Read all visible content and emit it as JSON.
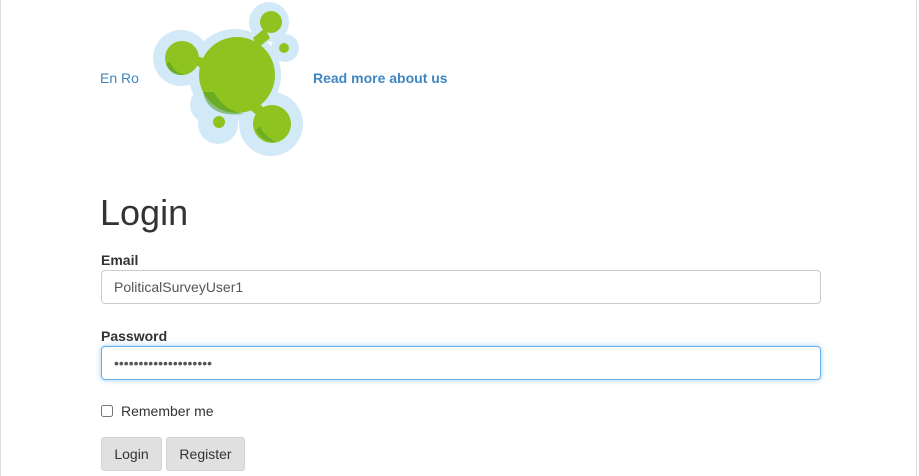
{
  "header": {
    "lang_en": "En",
    "lang_ro": "Ro",
    "about_link": "Read more about us",
    "logo_icon": "molecule-logo-icon"
  },
  "colors": {
    "link": "#3f86c1",
    "logo_green": "#8fc31f",
    "logo_halo": "#cfe8f7",
    "focus_border": "#66afe9",
    "button_bg": "#e0e0e0"
  },
  "login": {
    "title": "Login",
    "email_label": "Email",
    "email_value": "PoliticalSurveyUser1",
    "password_label": "Password",
    "password_value": "••••••••••••••••••••",
    "remember_label": "Remember me",
    "remember_checked": false,
    "login_button": "Login",
    "register_button": "Register"
  }
}
